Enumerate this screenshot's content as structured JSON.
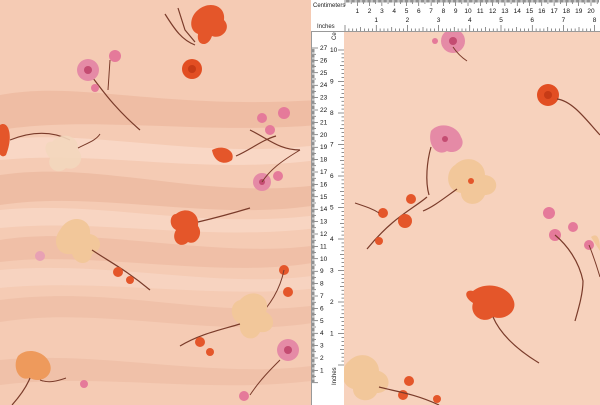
{
  "image": {
    "subject": "Peach jersey fabric with scattered orange and pink floral print",
    "background_color": "#f6cdb6"
  },
  "ruler": {
    "horizontal_cm_label": "Centimeters",
    "horizontal_in_label": "Inches",
    "vertical_cm_label": "Centimeters",
    "vertical_in_label": "Inches",
    "cm_numbers": [
      "1",
      "2",
      "3",
      "4",
      "5",
      "6",
      "7",
      "8",
      "9",
      "10",
      "11",
      "12",
      "13",
      "14",
      "15",
      "16",
      "17",
      "18",
      "19",
      "20",
      "21"
    ],
    "in_numbers": [
      "1",
      "2",
      "3",
      "4",
      "5",
      "6",
      "7",
      "8"
    ],
    "v_cm_numbers": [
      "27",
      "26",
      "25",
      "24",
      "23",
      "22",
      "21",
      "20",
      "19",
      "18",
      "17",
      "16",
      "15",
      "14",
      "13",
      "12",
      "11",
      "10",
      "9",
      "8",
      "7",
      "6",
      "5",
      "4",
      "3",
      "2",
      "1"
    ],
    "v_in_numbers": [
      "10",
      "9",
      "8",
      "7",
      "6",
      "5",
      "4",
      "3",
      "2",
      "1"
    ]
  },
  "colors": {
    "fabric": "#f6cdb6",
    "fabric_shadow": "#e9b59c",
    "orange_flower": "#e4562a",
    "pink_flower": "#e57a9a",
    "cream_flower": "#f2c79a",
    "stem": "#7a3b2a"
  }
}
